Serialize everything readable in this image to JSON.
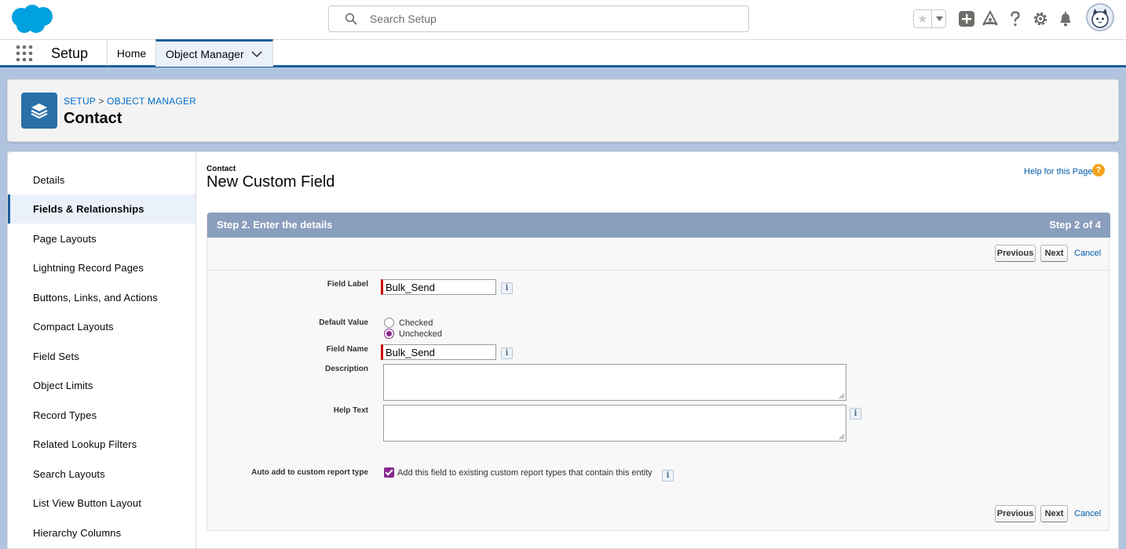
{
  "global_header": {
    "search_placeholder": "Search Setup",
    "icons": [
      "salesforce-logo",
      "search-icon",
      "favorites-star-icon",
      "chevron-down-icon",
      "global-actions-plus-icon",
      "trailhead-icon",
      "help-icon",
      "gear-icon",
      "bell-icon",
      "avatar"
    ]
  },
  "context_bar": {
    "app_name": "Setup",
    "tabs": [
      {
        "label": "Home"
      },
      {
        "label": "Object Manager",
        "active": true
      }
    ]
  },
  "page_header": {
    "breadcrumb": [
      "SETUP",
      "OBJECT MANAGER"
    ],
    "breadcrumb_sep": ">",
    "title": "Contact"
  },
  "sidebar": {
    "items": [
      {
        "label": "Details"
      },
      {
        "label": "Fields & Relationships",
        "active": true
      },
      {
        "label": "Page Layouts"
      },
      {
        "label": "Lightning Record Pages"
      },
      {
        "label": "Buttons, Links, and Actions"
      },
      {
        "label": "Compact Layouts"
      },
      {
        "label": "Field Sets"
      },
      {
        "label": "Object Limits"
      },
      {
        "label": "Record Types"
      },
      {
        "label": "Related Lookup Filters"
      },
      {
        "label": "Search Layouts"
      },
      {
        "label": "List View Button Layout"
      },
      {
        "label": "Hierarchy Columns"
      }
    ]
  },
  "form": {
    "object_label": "Contact",
    "title": "New Custom Field",
    "help_link": "Help for this Page",
    "help_glyph": "?",
    "step_title": "Step 2. Enter the details",
    "step_count": "Step 2 of 4",
    "buttons": {
      "previous": "Previous",
      "next": "Next",
      "cancel": "Cancel"
    },
    "info_glyph": "i",
    "fields": {
      "field_label": {
        "label": "Field Label",
        "value": "Bulk_Send"
      },
      "default_value": {
        "label": "Default Value",
        "options": [
          "Checked",
          "Unchecked"
        ],
        "selected": "Unchecked"
      },
      "field_name": {
        "label": "Field Name",
        "value": "Bulk_Send"
      },
      "description": {
        "label": "Description",
        "value": ""
      },
      "help_text": {
        "label": "Help Text",
        "value": ""
      },
      "auto_add": {
        "label": "Auto add to custom report type",
        "checkbox_label": "Add this field to existing custom report types that contain this entity",
        "checked": true
      }
    }
  },
  "colors": {
    "brand_blue": "#1b5f9e",
    "step_header": "#8a9ebe",
    "link": "#015ba7",
    "required": "#cc0000",
    "selection_purple": "#862a8d"
  }
}
